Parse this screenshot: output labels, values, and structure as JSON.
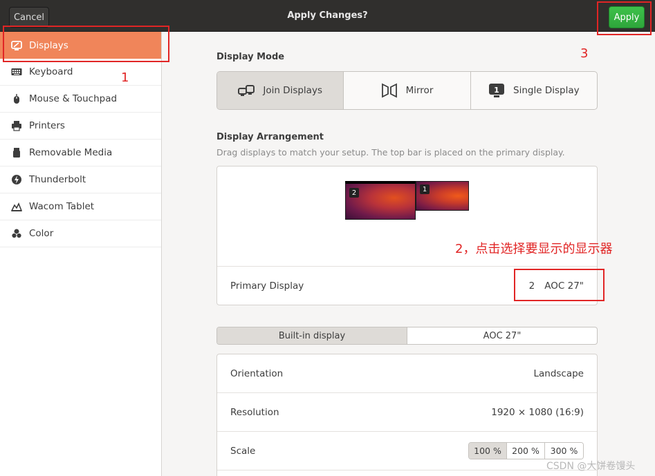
{
  "header": {
    "cancel_label": "Cancel",
    "title": "Apply Changes?",
    "apply_label": "Apply"
  },
  "sidebar": {
    "items": [
      {
        "label": "Displays",
        "icon": "display-icon",
        "active": true
      },
      {
        "label": "Keyboard",
        "icon": "keyboard-icon"
      },
      {
        "label": "Mouse & Touchpad",
        "icon": "mouse-icon"
      },
      {
        "label": "Printers",
        "icon": "printer-icon"
      },
      {
        "label": "Removable Media",
        "icon": "removable-media-icon"
      },
      {
        "label": "Thunderbolt",
        "icon": "thunderbolt-icon"
      },
      {
        "label": "Wacom Tablet",
        "icon": "wacom-tablet-icon"
      },
      {
        "label": "Color",
        "icon": "color-icon"
      }
    ]
  },
  "display_mode": {
    "heading": "Display Mode",
    "options": [
      {
        "label": "Join Displays",
        "icon": "join-displays-icon",
        "active": true
      },
      {
        "label": "Mirror",
        "icon": "mirror-icon"
      },
      {
        "label": "Single Display",
        "icon": "single-display-icon"
      }
    ],
    "single_display_badge": "1"
  },
  "arrangement": {
    "heading": "Display Arrangement",
    "description": "Drag displays to match your setup. The top bar is placed on the primary display.",
    "monitors": [
      {
        "number": "2"
      },
      {
        "number": "1"
      }
    ],
    "primary_label": "Primary Display",
    "primary_number": "2",
    "primary_name": "AOC 27\""
  },
  "display_tabs": [
    {
      "label": "Built-in display",
      "active": true
    },
    {
      "label": "AOC 27\""
    }
  ],
  "settings": {
    "orientation_label": "Orientation",
    "orientation_value": "Landscape",
    "resolution_label": "Resolution",
    "resolution_value": "1920 × 1080 (16:9)",
    "scale_label": "Scale",
    "scale_options": [
      "100 %",
      "200 %",
      "300 %"
    ]
  },
  "annotations": {
    "step1": "1",
    "step2": "2，点击选择要显示的显示器",
    "step3": "3"
  },
  "watermark": "CSDN @大饼卷馒头",
  "colors": {
    "accent": "#f0855a",
    "apply_green": "#2ea63b",
    "annotation_red": "#e12525"
  }
}
